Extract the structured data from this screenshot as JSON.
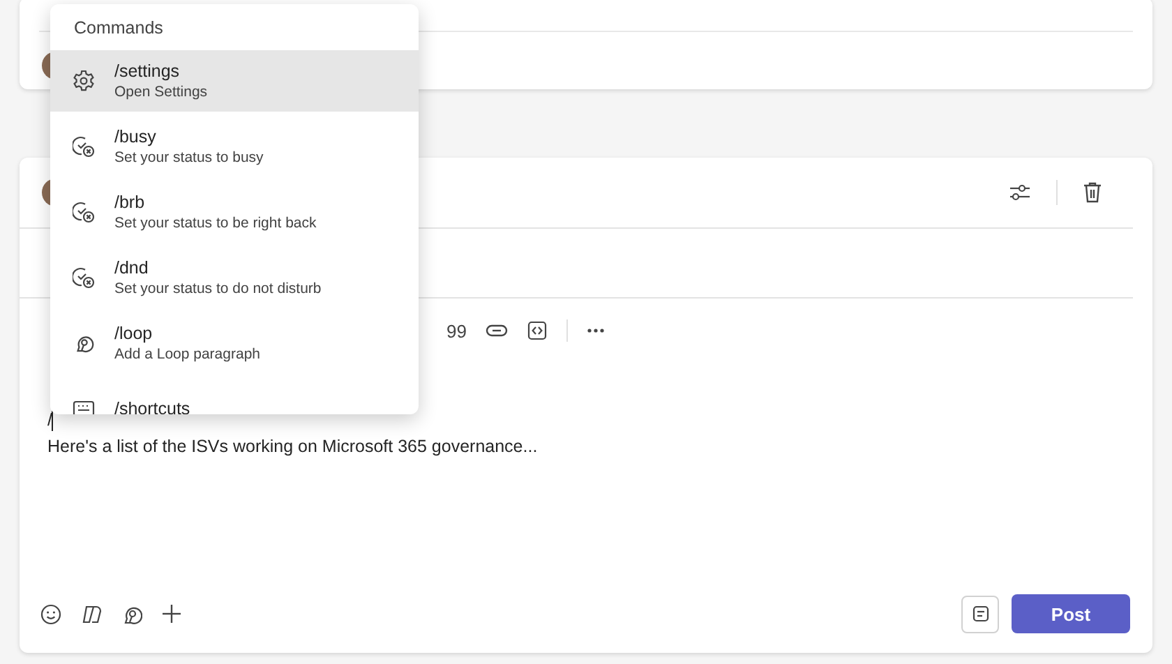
{
  "composer": {
    "toolbar": {
      "quote_label": "99"
    },
    "text_lines": [
      {
        "text": "/",
        "caret": true
      },
      {
        "text": "Here's a list of the ISVs working on Microsoft 365 governance...",
        "caret": false
      }
    ],
    "post_button": "Post"
  },
  "command_menu": {
    "title": "Commands",
    "items": [
      {
        "kind": "gear",
        "command": "/settings",
        "description": "Open Settings",
        "selected": true
      },
      {
        "kind": "status",
        "command": "/busy",
        "description": "Set your status to busy",
        "selected": false
      },
      {
        "kind": "status",
        "command": "/brb",
        "description": "Set your status to be right back",
        "selected": false
      },
      {
        "kind": "status",
        "command": "/dnd",
        "description": "Set your status to do not disturb",
        "selected": false
      },
      {
        "kind": "loop",
        "command": "/loop",
        "description": "Add a Loop paragraph",
        "selected": false
      },
      {
        "kind": "keyboard",
        "command": "/shortcuts",
        "selected": false
      }
    ]
  }
}
